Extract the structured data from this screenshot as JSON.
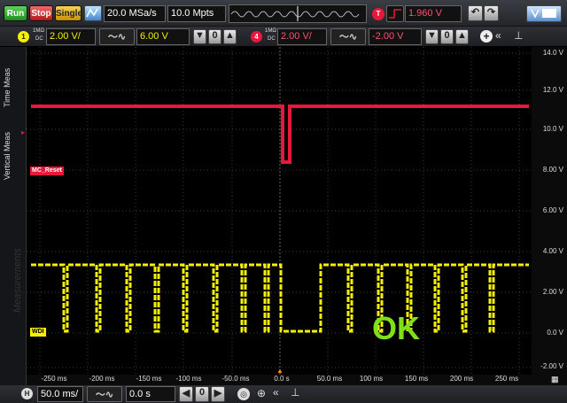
{
  "acquisition": {
    "run_label": "Run",
    "stop_label": "Stop",
    "single_label": "Single",
    "sample_rate": "20.0 MSa/s",
    "memory_depth": "10.0 Mpts"
  },
  "trigger": {
    "channel_label": "T",
    "level": "1.960 V"
  },
  "channel1": {
    "number": "1",
    "impedance": "1MΩ",
    "coupling": "DC",
    "scale": "2.00 V/",
    "offset": "6.00 V",
    "color": "#f4f000"
  },
  "channel4": {
    "number": "4",
    "impedance": "1MΩ",
    "coupling": "DC",
    "scale": "2.00 V/",
    "offset": "-2.00 V",
    "color": "#e8173b"
  },
  "sidebar": {
    "tab_time": "Time Meas",
    "tab_vertical": "Vertical Meas",
    "watermark": "Measurements"
  },
  "display": {
    "y_labels": [
      "14.0 V",
      "12.0 V",
      "10.0 V",
      "8.00 V",
      "6.00 V",
      "4.00 V",
      "2.00 V",
      "0.0 V",
      "-2.00 V"
    ],
    "x_labels": [
      "-250 ms",
      "-200 ms",
      "-150 ms",
      "-100 ms",
      "-50.0 ms",
      "0.0 s",
      "50.0 ms",
      "100 ms",
      "150 ms",
      "200 ms",
      "250 ms"
    ],
    "trace_label_red": "MC_Reset",
    "trace_label_yellow": "WDI",
    "ok_text": "OK",
    "ok_color": "#7fe01a"
  },
  "horizontal": {
    "label": "H",
    "timebase": "50.0 ms/",
    "delay": "0.0 s"
  }
}
